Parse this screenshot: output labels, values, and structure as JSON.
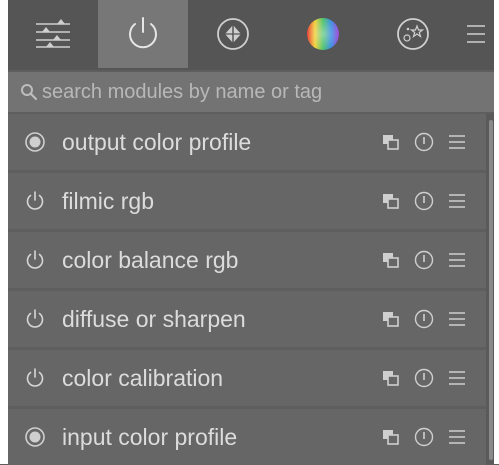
{
  "tabs": [
    {
      "name": "basic-adjustments-tab",
      "icon": "sliders-icon"
    },
    {
      "name": "active-modules-tab",
      "icon": "power-icon",
      "active": true
    },
    {
      "name": "technical-tab",
      "icon": "aperture-icon"
    },
    {
      "name": "color-tab",
      "icon": "color-wheel-icon"
    },
    {
      "name": "effects-tab",
      "icon": "effects-icon"
    },
    {
      "name": "menu-tab",
      "icon": "hamburger-icon"
    }
  ],
  "search": {
    "placeholder": "search modules by name or tag",
    "value": ""
  },
  "modules": [
    {
      "label": "output color profile",
      "state": "always-on"
    },
    {
      "label": "filmic rgb",
      "state": "power"
    },
    {
      "label": "color balance rgb",
      "state": "power"
    },
    {
      "label": "diffuse or sharpen",
      "state": "power"
    },
    {
      "label": "color calibration",
      "state": "power"
    },
    {
      "label": "input color profile",
      "state": "always-on"
    }
  ],
  "colors": {
    "background": "#5e5e5e",
    "row": "#666666",
    "text": "#dcdcdc",
    "active_tab": "#777777"
  }
}
